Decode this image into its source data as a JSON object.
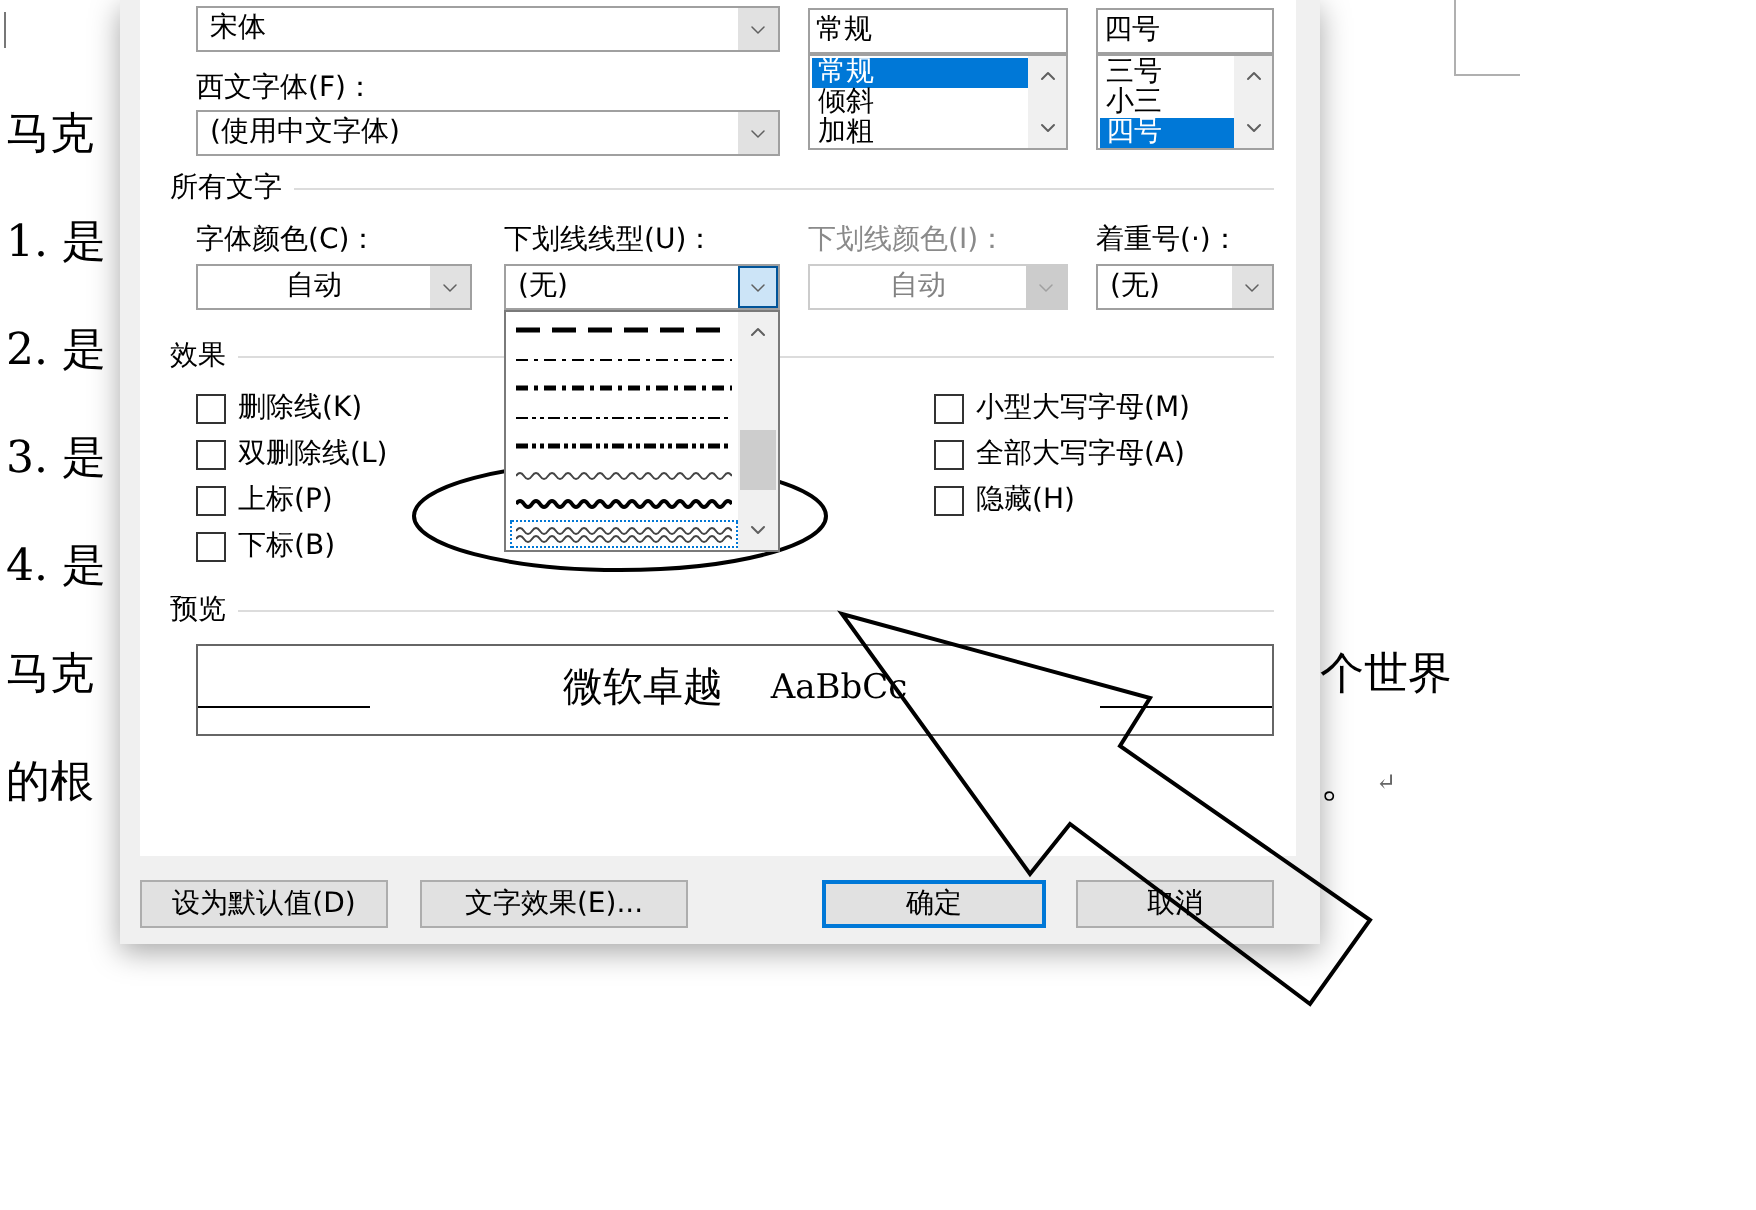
{
  "document": {
    "lines": [
      {
        "left": "马克"
      },
      {
        "left": "1. 是"
      },
      {
        "left": "2. 是"
      },
      {
        "left": "3. 是"
      },
      {
        "left": "4. 是"
      },
      {
        "left": "马克",
        "right": "个世界"
      },
      {
        "left": "的根",
        "right": "。",
        "paragraph_mark": "↵"
      }
    ]
  },
  "font_dialog": {
    "chinese_font": {
      "value": "宋体"
    },
    "western_font": {
      "label": "西文字体(F)：",
      "value": "(使用中文字体)"
    },
    "style": {
      "value": "常规",
      "options": [
        {
          "label": "常规",
          "selected": true
        },
        {
          "label": "倾斜",
          "selected": false
        },
        {
          "label": "加粗",
          "selected": false
        }
      ]
    },
    "size": {
      "value": "四号",
      "options": [
        {
          "label": "三号",
          "selected": false
        },
        {
          "label": "小三",
          "selected": false
        },
        {
          "label": "四号",
          "selected": true
        }
      ]
    },
    "all_text": {
      "title": "所有文字",
      "fields": [
        {
          "label": "字体颜色(C)：",
          "value": "自动",
          "kind": "color",
          "disabled": false,
          "focused": false
        },
        {
          "label": "下划线线型(U)：",
          "value": "(无)",
          "kind": "list",
          "disabled": false,
          "focused": true
        },
        {
          "label": "下划线颜色(I)：",
          "value": "自动",
          "kind": "color",
          "disabled": true,
          "focused": false
        },
        {
          "label": "着重号(·)：",
          "value": "(无)",
          "kind": "list",
          "disabled": false,
          "focused": false
        }
      ]
    },
    "underline_style_dropdown": {
      "items": [
        {
          "kind": "dash-long",
          "selected": false
        },
        {
          "kind": "dash-dot",
          "selected": false
        },
        {
          "kind": "dash-dot-heavy",
          "selected": false
        },
        {
          "kind": "dash-dot-dot",
          "selected": false
        },
        {
          "kind": "dash-dot-dot-heavy",
          "selected": false
        },
        {
          "kind": "wave",
          "selected": false
        },
        {
          "kind": "wave-heavy",
          "selected": false
        },
        {
          "kind": "wave-double",
          "selected": true
        }
      ]
    },
    "effects": {
      "title": "效果",
      "columns": [
        [
          {
            "label": "删除线(K)",
            "checked": false
          },
          {
            "label": "双删除线(L)",
            "checked": false
          },
          {
            "label": "上标(P)",
            "checked": false
          },
          {
            "label": "下标(B)",
            "checked": false
          }
        ],
        [
          {
            "label": "小型大写字母(M)",
            "checked": false
          },
          {
            "label": "全部大写字母(A)",
            "checked": false
          },
          {
            "label": "隐藏(H)",
            "checked": false
          }
        ]
      ]
    },
    "preview": {
      "title": "预览",
      "text": "微软卓越",
      "latin_text": "AaBbCc"
    },
    "buttons": [
      {
        "label": "设为默认值(D)",
        "default": false
      },
      {
        "label": "文字效果(E)...",
        "default": false
      },
      {
        "label": "确定",
        "default": true
      },
      {
        "label": "取消",
        "default": false
      }
    ]
  },
  "annotations": {
    "ellipse": true,
    "arrow": true
  }
}
